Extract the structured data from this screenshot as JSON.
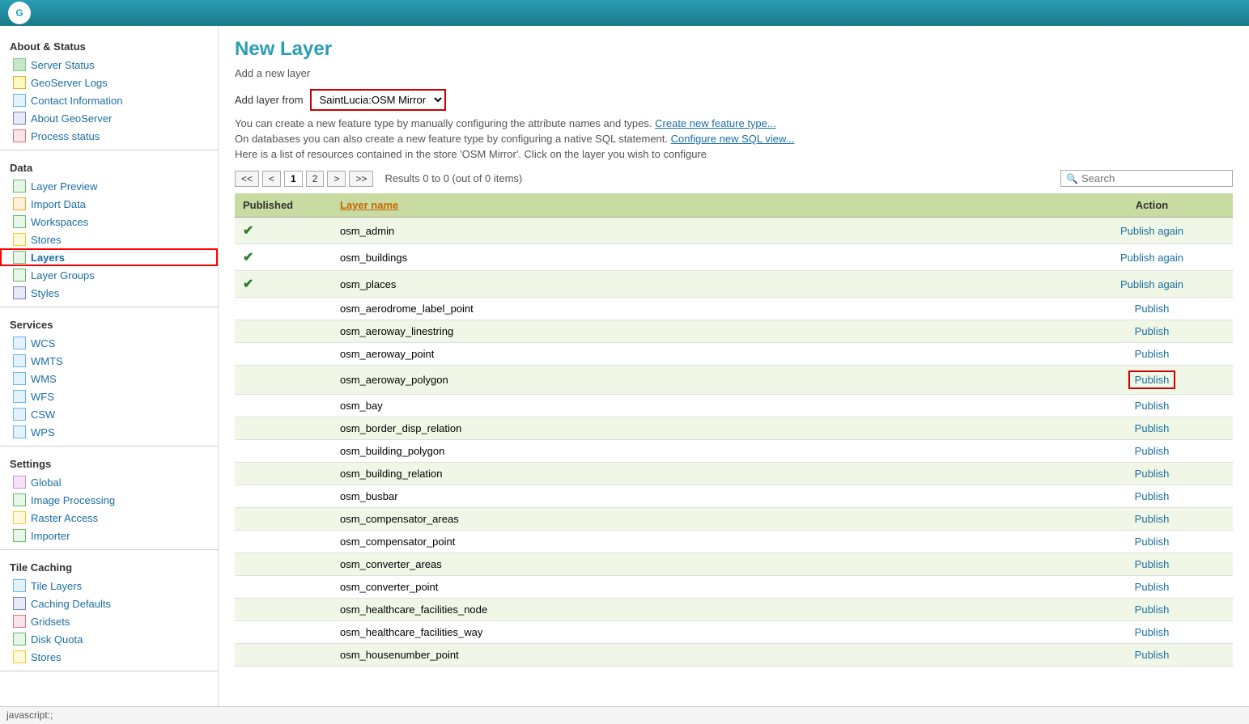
{
  "topbar": {
    "logo_text": "G"
  },
  "sidebar": {
    "sections": [
      {
        "title": "About & Status",
        "items": [
          {
            "label": "Server Status",
            "icon": "server",
            "active": false
          },
          {
            "label": "GeoServer Logs",
            "icon": "log",
            "active": false
          },
          {
            "label": "Contact Information",
            "icon": "contact",
            "active": false
          },
          {
            "label": "About GeoServer",
            "icon": "about",
            "active": false
          },
          {
            "label": "Process status",
            "icon": "process",
            "active": false
          }
        ]
      },
      {
        "title": "Data",
        "items": [
          {
            "label": "Layer Preview",
            "icon": "layer-preview",
            "active": false
          },
          {
            "label": "Import Data",
            "icon": "import",
            "active": false
          },
          {
            "label": "Workspaces",
            "icon": "workspace",
            "active": false
          },
          {
            "label": "Stores",
            "icon": "stores",
            "active": false
          },
          {
            "label": "Layers",
            "icon": "layers",
            "active": true
          },
          {
            "label": "Layer Groups",
            "icon": "layergroups",
            "active": false
          },
          {
            "label": "Styles",
            "icon": "styles",
            "active": false
          }
        ]
      },
      {
        "title": "Services",
        "items": [
          {
            "label": "WCS",
            "icon": "wcs",
            "active": false
          },
          {
            "label": "WMTS",
            "icon": "wms",
            "active": false
          },
          {
            "label": "WMS",
            "icon": "wms",
            "active": false
          },
          {
            "label": "WFS",
            "icon": "wfs",
            "active": false
          },
          {
            "label": "CSW",
            "icon": "wcs",
            "active": false
          },
          {
            "label": "WPS",
            "icon": "wps",
            "active": false
          }
        ]
      },
      {
        "title": "Settings",
        "items": [
          {
            "label": "Global",
            "icon": "global",
            "active": false
          },
          {
            "label": "Image Processing",
            "icon": "image",
            "active": false
          },
          {
            "label": "Raster Access",
            "icon": "raster",
            "active": false
          },
          {
            "label": "Importer",
            "icon": "importer",
            "active": false
          }
        ]
      },
      {
        "title": "Tile Caching",
        "items": [
          {
            "label": "Tile Layers",
            "icon": "tile",
            "active": false
          },
          {
            "label": "Caching Defaults",
            "icon": "caching",
            "active": false
          },
          {
            "label": "Gridsets",
            "icon": "grid",
            "active": false
          },
          {
            "label": "Disk Quota",
            "icon": "disk",
            "active": false
          },
          {
            "label": "Stores",
            "icon": "stores",
            "active": false
          }
        ]
      }
    ]
  },
  "content": {
    "page_title": "New Layer",
    "subtitle": "Add a new layer",
    "add_layer_label": "Add layer from",
    "store_select_value": "SaintLucia:OSM Mirror",
    "store_options": [
      "SaintLucia:OSM Mirror"
    ],
    "info_line1_before": "You can create a new feature type by manually configuring the attribute names and types.",
    "info_link1": "Create new feature type...",
    "info_line2_before": "On databases you can also create a new feature type by configuring a native SQL statement.",
    "info_link2": "Configure new SQL view...",
    "info_line3": "Here is a list of resources contained in the store 'OSM Mirror'. Click on the layer you wish to configure",
    "pagination": {
      "first": "<<",
      "prev": "<",
      "page1": "1",
      "page2": "2",
      "next": ">",
      "last": ">>",
      "results_text": "Results 0 to 0 (out of 0 items)"
    },
    "search_placeholder": "Search",
    "table": {
      "col_published": "Published",
      "col_layer_name": "Layer name",
      "col_action": "Action",
      "rows": [
        {
          "published": true,
          "layer_name": "osm_admin",
          "action": "Publish again",
          "highlighted": false
        },
        {
          "published": true,
          "layer_name": "osm_buildings",
          "action": "Publish again",
          "highlighted": false
        },
        {
          "published": true,
          "layer_name": "osm_places",
          "action": "Publish again",
          "highlighted": false
        },
        {
          "published": false,
          "layer_name": "osm_aerodrome_label_point",
          "action": "Publish",
          "highlighted": false
        },
        {
          "published": false,
          "layer_name": "osm_aeroway_linestring",
          "action": "Publish",
          "highlighted": false
        },
        {
          "published": false,
          "layer_name": "osm_aeroway_point",
          "action": "Publish",
          "highlighted": false
        },
        {
          "published": false,
          "layer_name": "osm_aeroway_polygon",
          "action": "Publish",
          "highlighted": true
        },
        {
          "published": false,
          "layer_name": "osm_bay",
          "action": "Publish",
          "highlighted": false
        },
        {
          "published": false,
          "layer_name": "osm_border_disp_relation",
          "action": "Publish",
          "highlighted": false
        },
        {
          "published": false,
          "layer_name": "osm_building_polygon",
          "action": "Publish",
          "highlighted": false
        },
        {
          "published": false,
          "layer_name": "osm_building_relation",
          "action": "Publish",
          "highlighted": false
        },
        {
          "published": false,
          "layer_name": "osm_busbar",
          "action": "Publish",
          "highlighted": false
        },
        {
          "published": false,
          "layer_name": "osm_compensator_areas",
          "action": "Publish",
          "highlighted": false
        },
        {
          "published": false,
          "layer_name": "osm_compensator_point",
          "action": "Publish",
          "highlighted": false
        },
        {
          "published": false,
          "layer_name": "osm_converter_areas",
          "action": "Publish",
          "highlighted": false
        },
        {
          "published": false,
          "layer_name": "osm_converter_point",
          "action": "Publish",
          "highlighted": false
        },
        {
          "published": false,
          "layer_name": "osm_healthcare_facilities_node",
          "action": "Publish",
          "highlighted": false
        },
        {
          "published": false,
          "layer_name": "osm_healthcare_facilities_way",
          "action": "Publish",
          "highlighted": false
        },
        {
          "published": false,
          "layer_name": "osm_housenumber_point",
          "action": "Publish",
          "highlighted": false
        }
      ]
    }
  },
  "statusbar": {
    "text": "javascript:;"
  }
}
